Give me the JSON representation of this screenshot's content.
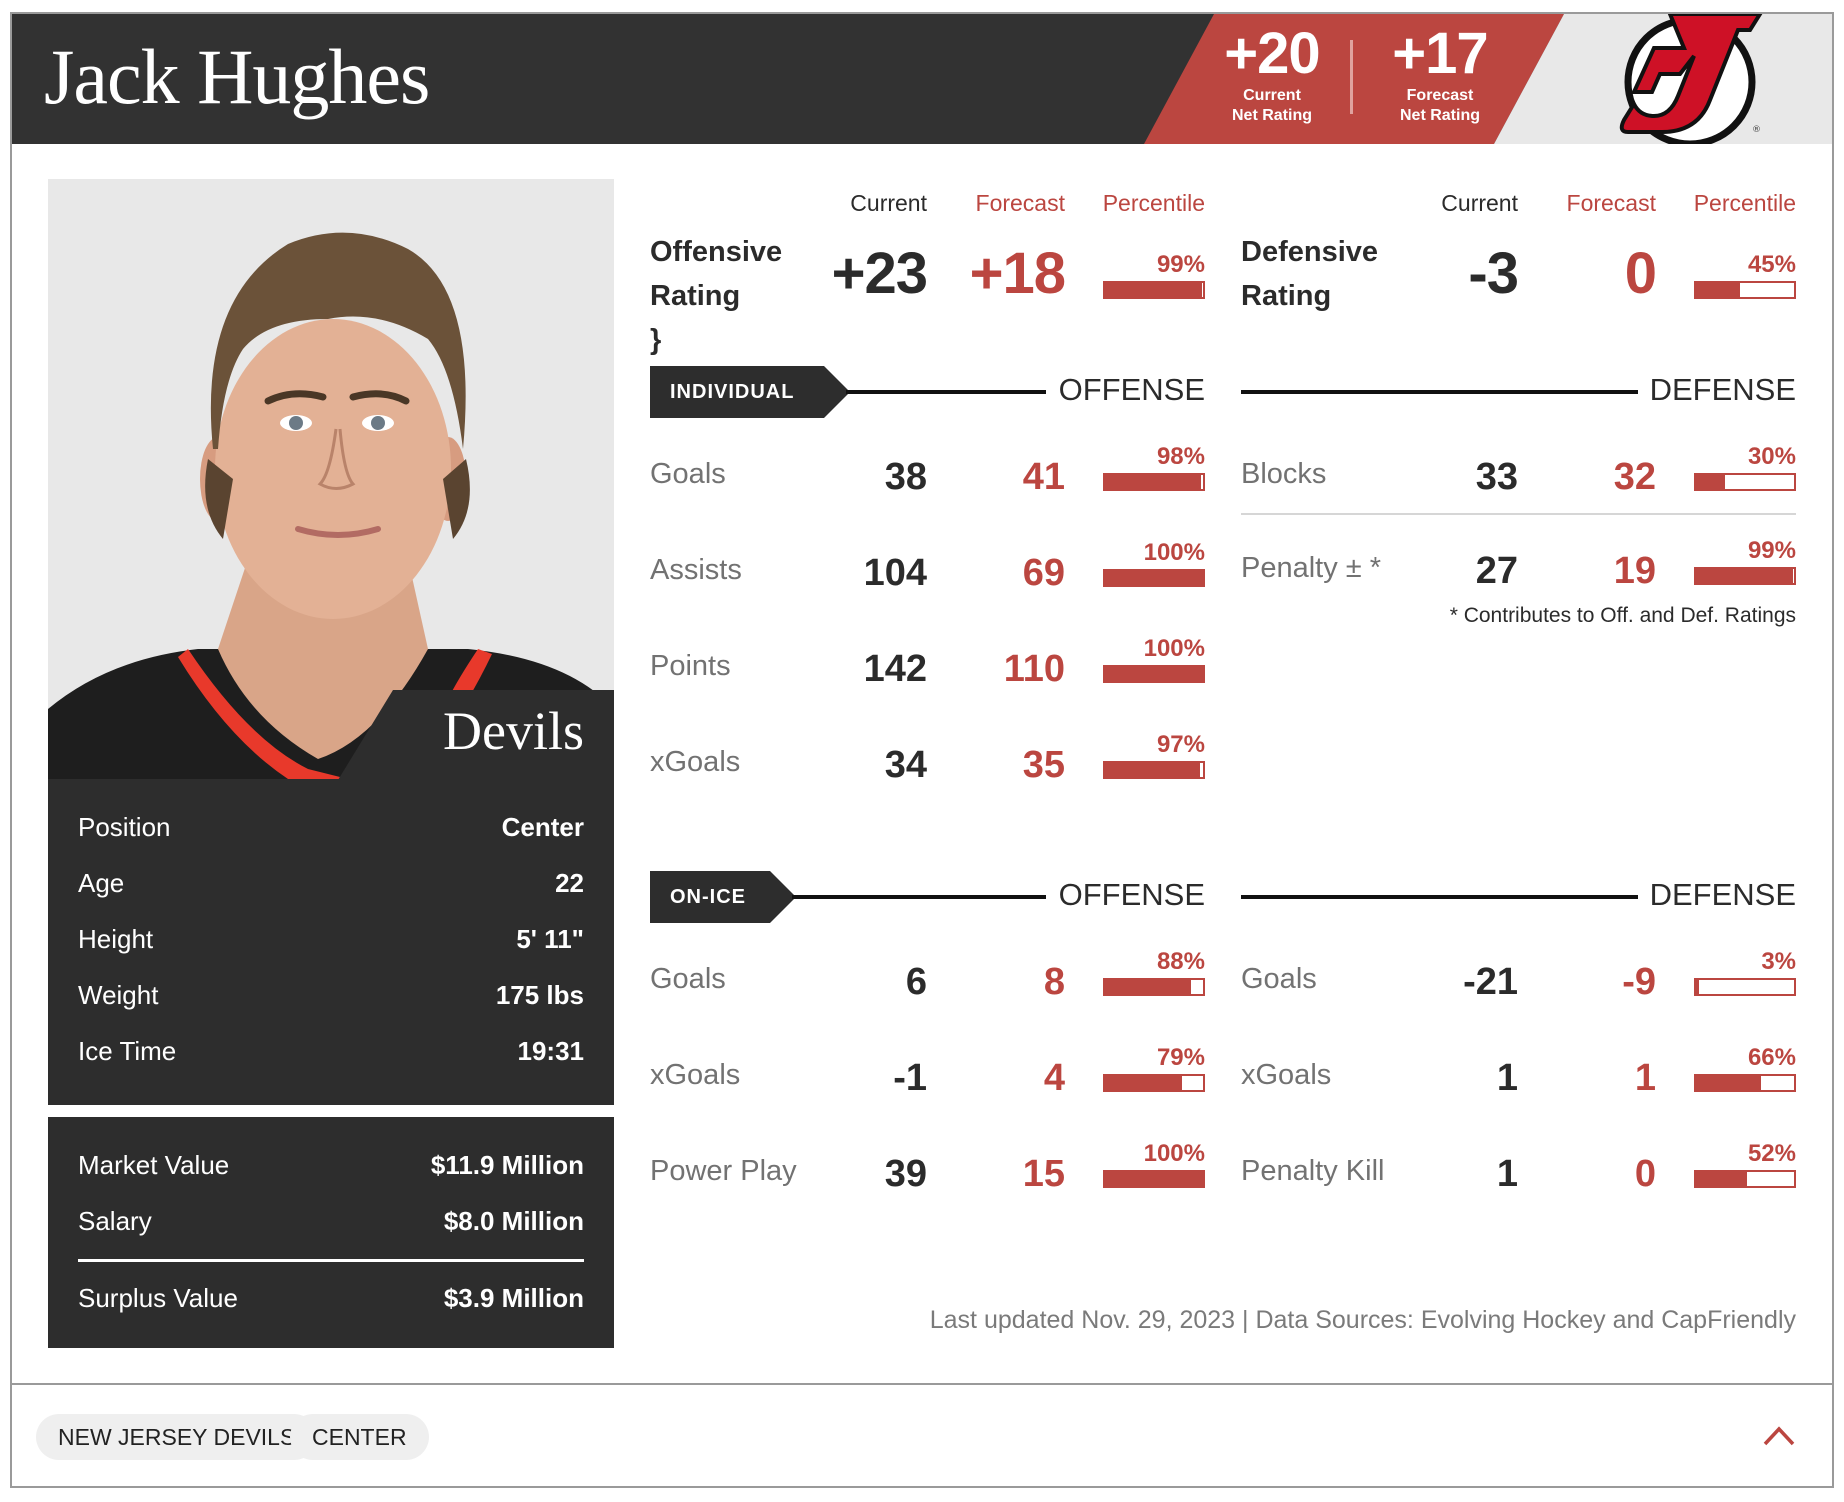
{
  "header": {
    "player_name": "Jack Hughes",
    "current_net_rating": {
      "value": "+20",
      "label_line1": "Current",
      "label_line2": "Net Rating"
    },
    "forecast_net_rating": {
      "value": "+17",
      "label_line1": "Forecast",
      "label_line2": "Net Rating"
    },
    "logo_icon": "new-jersey-devils-logo"
  },
  "profile": {
    "team_name": "Devils",
    "photo_alt": "player headshot",
    "info": [
      {
        "label": "Position",
        "value": "Center"
      },
      {
        "label": "Age",
        "value": "22"
      },
      {
        "label": "Height",
        "value": "5' 11\""
      },
      {
        "label": "Weight",
        "value": "175 lbs"
      },
      {
        "label": "Ice Time",
        "value": "19:31"
      }
    ],
    "money": [
      {
        "label": "Market Value",
        "value": "$11.9 Million"
      },
      {
        "label": "Salary",
        "value": "$8.0 Million"
      }
    ],
    "surplus": {
      "label": "Surplus Value",
      "value": "$3.9 Million"
    }
  },
  "column_headers": {
    "current": "Current",
    "forecast": "Forecast",
    "percentile": "Percentile"
  },
  "offensive_rating": {
    "label_line1": "Offensive",
    "label_line2": "Rating",
    "current": "+23",
    "forecast": "+18",
    "percentile_label": "99%",
    "percentile": 99
  },
  "defensive_rating": {
    "label_line1": "Defensive",
    "label_line2": "Rating",
    "current": "-3",
    "forecast": "0",
    "percentile_label": "45%",
    "percentile": 45
  },
  "individual": {
    "tag": "INDIVIDUAL",
    "offense_title": "OFFENSE",
    "defense_title": "DEFENSE",
    "offense": [
      {
        "label": "Goals",
        "current": "38",
        "forecast": "41",
        "percentile_label": "98%",
        "percentile": 98
      },
      {
        "label": "Assists",
        "current": "104",
        "forecast": "69",
        "percentile_label": "100%",
        "percentile": 100
      },
      {
        "label": "Points",
        "current": "142",
        "forecast": "110",
        "percentile_label": "100%",
        "percentile": 100
      },
      {
        "label": "xGoals",
        "current": "34",
        "forecast": "35",
        "percentile_label": "97%",
        "percentile": 97
      }
    ],
    "defense": [
      {
        "label": "Blocks",
        "current": "33",
        "forecast": "32",
        "percentile_label": "30%",
        "percentile": 30
      },
      {
        "label": "Penalty ± *",
        "current": "27",
        "forecast": "19",
        "percentile_label": "99%",
        "percentile": 99
      }
    ],
    "footnote": "* Contributes to Off. and Def. Ratings"
  },
  "on_ice": {
    "tag": "ON-ICE",
    "offense_title": "OFFENSE",
    "defense_title": "DEFENSE",
    "offense": [
      {
        "label": "Goals",
        "current": "6",
        "forecast": "8",
        "percentile_label": "88%",
        "percentile": 88
      },
      {
        "label": "xGoals",
        "current": "-1",
        "forecast": "4",
        "percentile_label": "79%",
        "percentile": 79
      },
      {
        "label": "Power Play",
        "current": "39",
        "forecast": "15",
        "percentile_label": "100%",
        "percentile": 100
      }
    ],
    "defense": [
      {
        "label": "Goals",
        "current": "-21",
        "forecast": "-9",
        "percentile_label": "3%",
        "percentile": 3
      },
      {
        "label": "xGoals",
        "current": "1",
        "forecast": "1",
        "percentile_label": "66%",
        "percentile": 66
      },
      {
        "label": "Penalty Kill",
        "current": "1",
        "forecast": "0",
        "percentile_label": "52%",
        "percentile": 52
      }
    ]
  },
  "updated_text": "Last updated Nov. 29, 2023 | Data Sources: Evolving Hockey and CapFriendly",
  "footer": {
    "tags": [
      "NEW JERSEY DEVILS",
      "CENTER"
    ],
    "collapse_icon": "chevron-up-icon"
  },
  "colors": {
    "accent": "#bb4640",
    "dark": "#2d2d2d",
    "header_bg": "#323232",
    "logo_red": "#ce1126"
  }
}
